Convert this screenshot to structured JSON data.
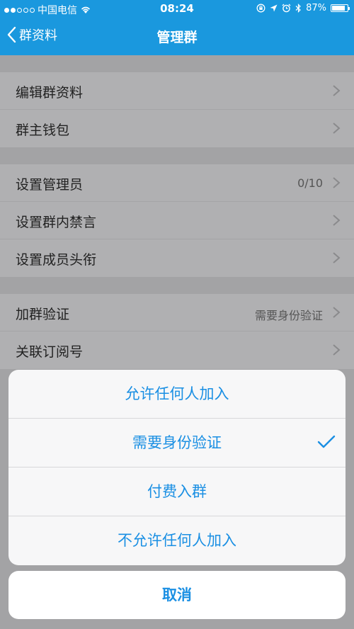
{
  "status_bar": {
    "carrier": "中国电信",
    "time": "08:24",
    "battery": "87%",
    "battery_level": 0.87,
    "icons": [
      "signal-dots-icon",
      "wifi-icon",
      "lock-rotation-icon",
      "location-icon",
      "alarm-icon",
      "bluetooth-icon",
      "battery-icon"
    ]
  },
  "nav": {
    "back_label": "群资料",
    "title": "管理群"
  },
  "groups": [
    {
      "items": [
        {
          "label": "编辑群资料",
          "value": ""
        },
        {
          "label": "群主钱包",
          "value": ""
        }
      ]
    },
    {
      "items": [
        {
          "label": "设置管理员",
          "value": "0/10"
        },
        {
          "label": "设置群内禁言",
          "value": ""
        },
        {
          "label": "设置成员头衔",
          "value": ""
        }
      ]
    },
    {
      "items": [
        {
          "label": "加群验证",
          "value": "需要身份验证"
        },
        {
          "label": "关联订阅号",
          "value": ""
        }
      ]
    }
  ],
  "action_sheet": {
    "options": [
      {
        "label": "允许任何人加入",
        "selected": false
      },
      {
        "label": "需要身份验证",
        "selected": true
      },
      {
        "label": "付费入群",
        "selected": false
      },
      {
        "label": "不允许任何人加入",
        "selected": false
      }
    ],
    "cancel_label": "取消"
  },
  "colors": {
    "brand_blue": "#1a98de",
    "action_text": "#1a8fe3"
  }
}
